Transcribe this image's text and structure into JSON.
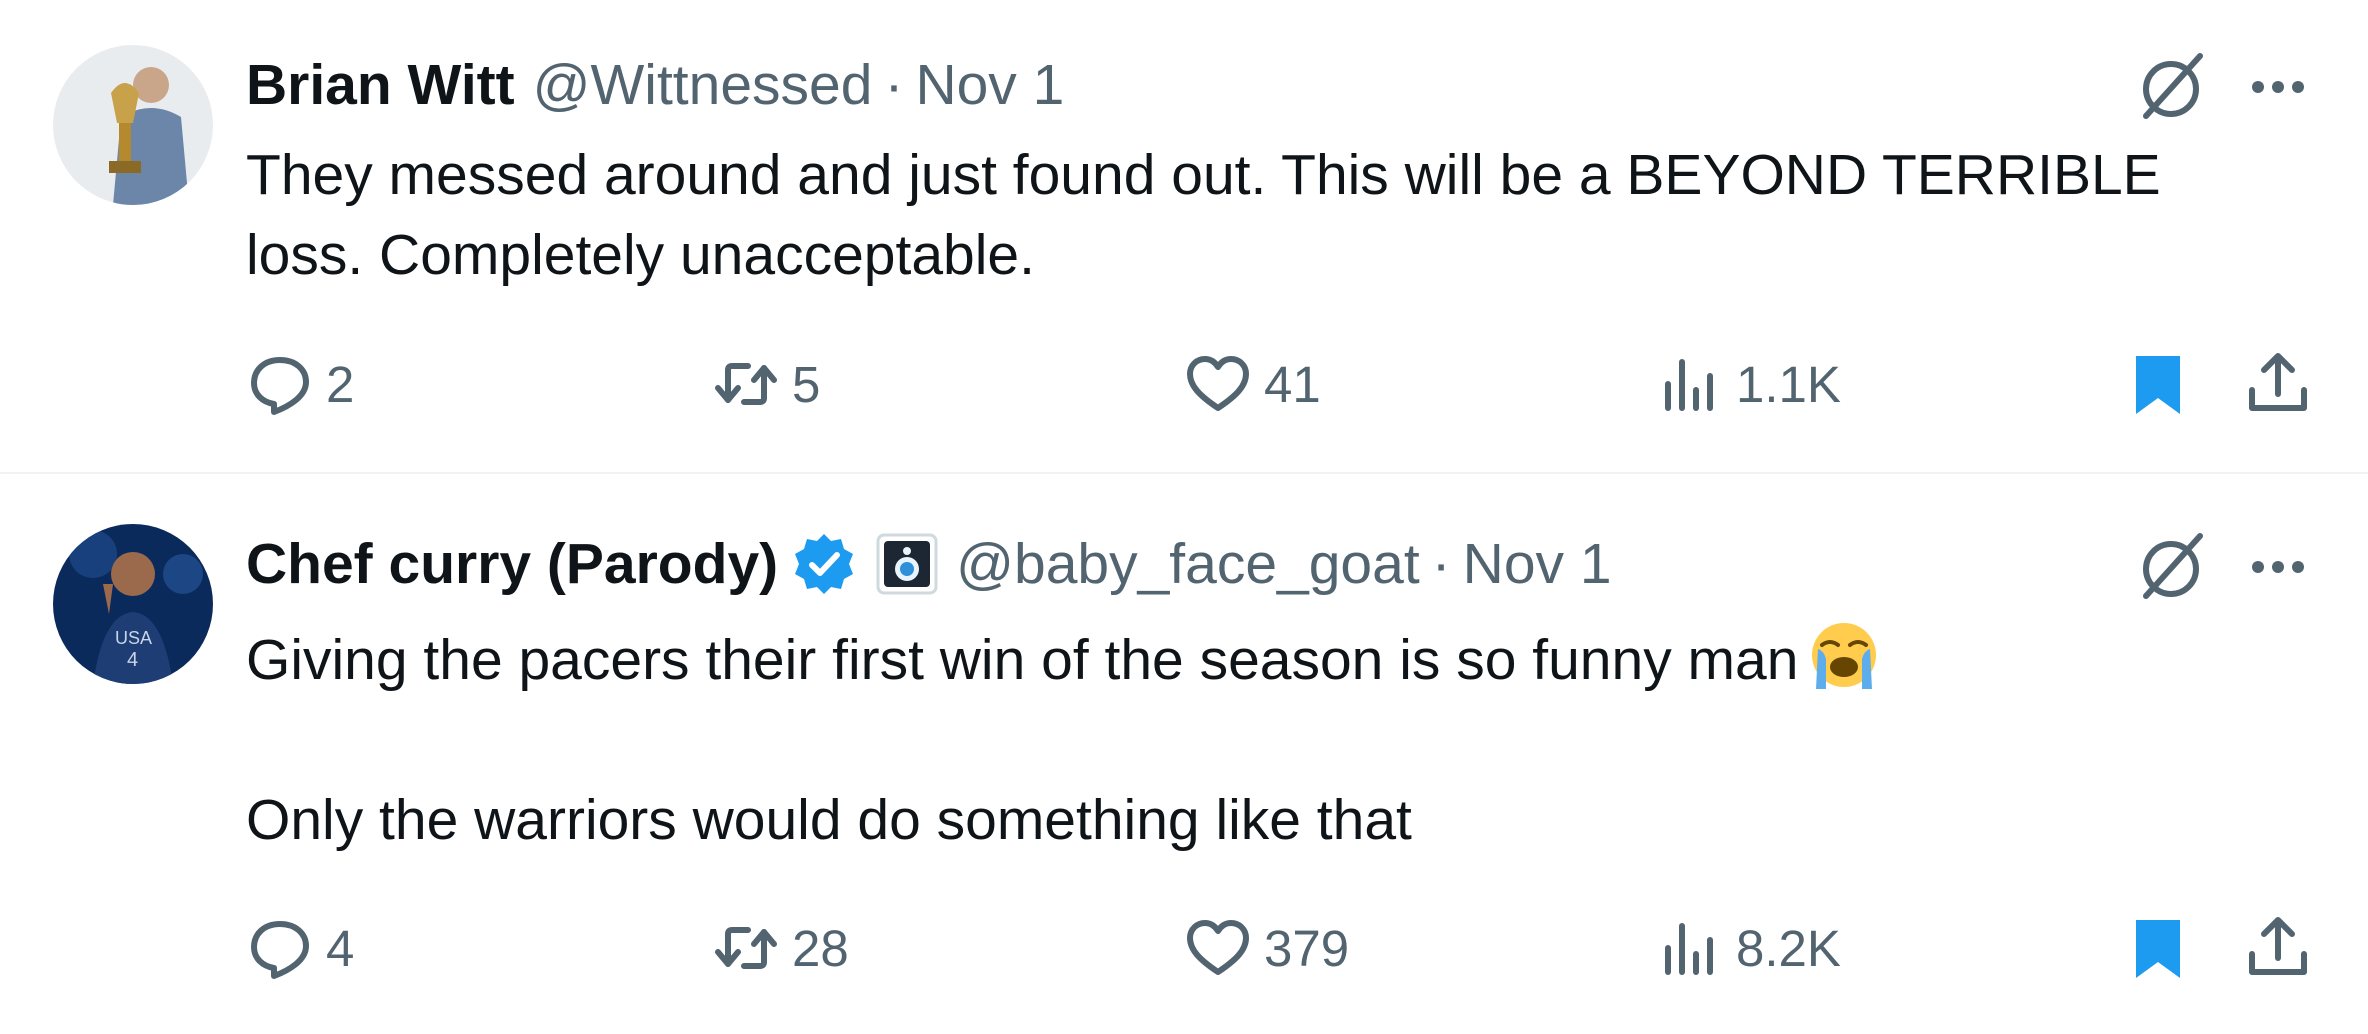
{
  "tweets": [
    {
      "name": "Brian Witt",
      "handle": "@Wittnessed",
      "separator": "·",
      "date": "Nov 1",
      "verified": false,
      "paragraphs": [
        "They messed around and just found out. This will be a BEYOND TERRIBLE loss. Completely unacceptable."
      ],
      "replies": "2",
      "reposts": "5",
      "likes": "41",
      "views": "1.1K",
      "bookmarked": true
    },
    {
      "name": "Chef curry (Parody)",
      "handle": "@baby_face_goat",
      "separator": "·",
      "date": "Nov 1",
      "verified": true,
      "paragraphs": [
        "Giving the pacers their first win of the season is so funny man",
        "Only the warriors would do something like that"
      ],
      "emoji": "loudly-crying-face",
      "replies": "4",
      "reposts": "28",
      "likes": "379",
      "views": "8.2K",
      "bookmarked": true
    }
  ],
  "colors": {
    "text": "#0f1419",
    "muted": "#536471",
    "accent": "#1d9bf0",
    "divider": "#eff3f4"
  },
  "icons": [
    "reply-icon",
    "repost-icon",
    "like-icon",
    "views-icon",
    "bookmark-icon",
    "share-icon",
    "grok-icon",
    "more-icon",
    "verified-badge-icon"
  ]
}
